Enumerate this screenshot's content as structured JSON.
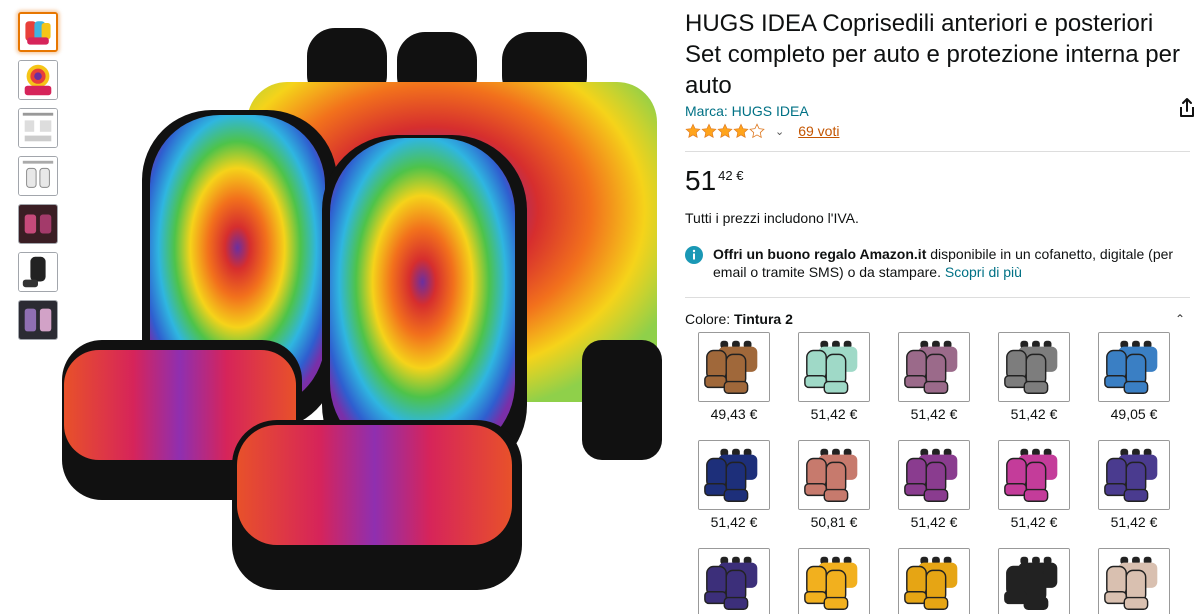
{
  "product": {
    "title_line1": "HUGS IDEA Coprisedili anteriori e posteriori",
    "title_line2": "Set completo per auto e protezione interna per",
    "title_line3": "auto",
    "brand": "Marca: HUGS IDEA",
    "rating": 4.0,
    "votes": "69 voti",
    "price_int": "51",
    "price_frac": "42 €",
    "vat_note": "Tutti i prezzi includono l'IVA.",
    "gift_bold": "Offri un buono regalo Amazon.it",
    "gift_text": " disponibile in un cofanetto, digitale (per email o tramite SMS) o da stampare. ",
    "gift_link": "Scopri di più",
    "color_label": "Colore: ",
    "color_value": "Tintura 2"
  },
  "thumbnails": [
    {
      "name": "tie-dye-set"
    },
    {
      "name": "tie-dye-swirl"
    },
    {
      "name": "compatibility-guide"
    },
    {
      "name": "seat-diagram"
    },
    {
      "name": "car-interior"
    },
    {
      "name": "seat-cover-black"
    },
    {
      "name": "interior-photo"
    }
  ],
  "swatches": [
    {
      "price": "49,43 €",
      "color": "#a0683a"
    },
    {
      "price": "51,42 €",
      "color": "#9fd9c7"
    },
    {
      "price": "51,42 €",
      "color": "#9b6a8a"
    },
    {
      "price": "51,42 €",
      "color": "#7d7d7d"
    },
    {
      "price": "49,05 €",
      "color": "#3a7fc4"
    },
    {
      "price": "51,42 €",
      "color": "#1d2f7a"
    },
    {
      "price": "50,81 €",
      "color": "#c77a6d"
    },
    {
      "price": "51,42 €",
      "color": "#8a3c8f"
    },
    {
      "price": "51,42 €",
      "color": "#c43c9a"
    },
    {
      "price": "51,42 €",
      "color": "#4a3b8f"
    },
    {
      "price": "",
      "color": "#3c2f7a"
    },
    {
      "price": "",
      "color": "#f2b01e"
    },
    {
      "price": "",
      "color": "#e6a514"
    },
    {
      "price": "",
      "color": "#222222"
    },
    {
      "price": "",
      "color": "#d9c0b0"
    }
  ],
  "colors": {
    "link": "#007185",
    "votes": "#c45500",
    "star": "#ffa41c",
    "selected_border": "#e77600"
  }
}
